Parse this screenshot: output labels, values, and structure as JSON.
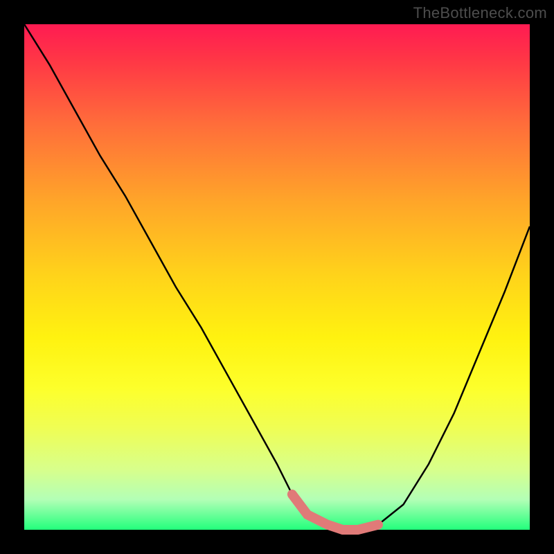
{
  "watermark": "TheBottleneck.com",
  "chart_data": {
    "type": "line",
    "title": "",
    "xlabel": "",
    "ylabel": "",
    "xlim": [
      0,
      100
    ],
    "ylim": [
      0,
      100
    ],
    "x": [
      0,
      5,
      10,
      15,
      20,
      25,
      30,
      35,
      40,
      45,
      50,
      53,
      56,
      60,
      63,
      66,
      70,
      75,
      80,
      85,
      90,
      95,
      100
    ],
    "values": [
      100,
      92,
      83,
      74,
      66,
      57,
      48,
      40,
      31,
      22,
      13,
      7,
      3,
      1,
      0,
      0,
      1,
      5,
      13,
      23,
      35,
      47,
      60
    ],
    "highlight_band": {
      "x_start": 53,
      "x_end": 70,
      "color": "#e07a78"
    },
    "gradient_stops": [
      {
        "pos": 0.0,
        "color": "#ff1b52"
      },
      {
        "pos": 0.5,
        "color": "#ffd41a"
      },
      {
        "pos": 1.0,
        "color": "#22ff7c"
      }
    ]
  }
}
